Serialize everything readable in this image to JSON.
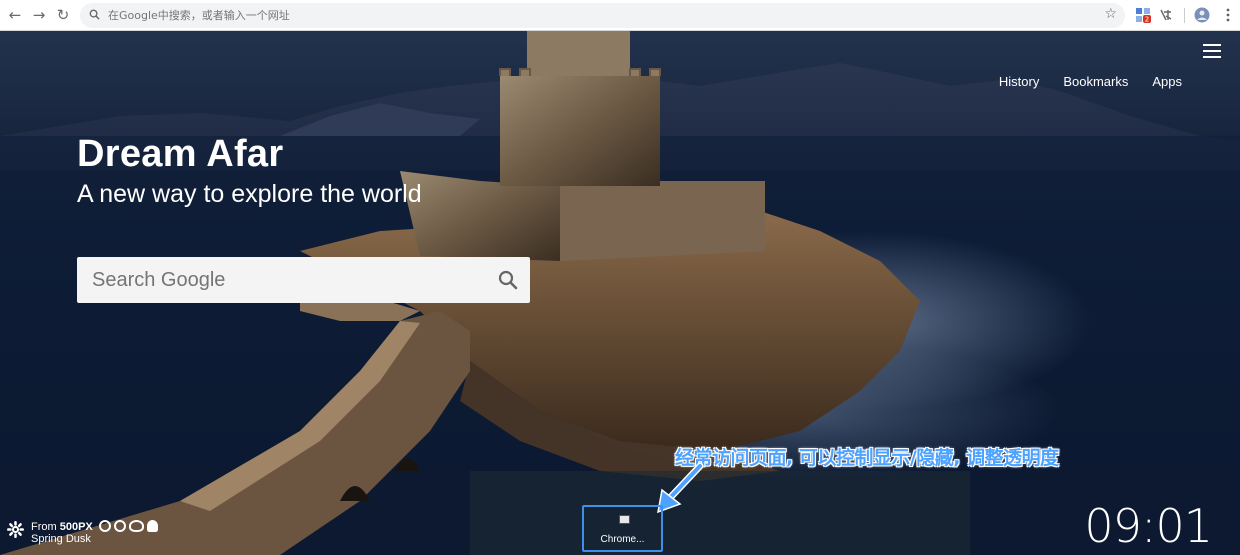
{
  "browser": {
    "address_placeholder": "在Google中搜索，或者输入一个网址",
    "back_icon": "back-arrow-icon",
    "forward_icon": "forward-arrow-icon",
    "reload_icon": "reload-icon",
    "extension_badge": "2"
  },
  "nav": {
    "history": "History",
    "bookmarks": "Bookmarks",
    "apps": "Apps"
  },
  "brand": {
    "title": "Dream Afar",
    "subtitle": "A new way to explore the world"
  },
  "search": {
    "placeholder": "Search Google"
  },
  "annotation": {
    "text": "经常访问页面, 可以控制显示/隐藏, 调整透明度"
  },
  "shortcut": {
    "label": "Chrome..."
  },
  "credits": {
    "prefix": "From ",
    "source": "500PX",
    "photo_title": "Spring Dusk"
  },
  "clock": {
    "time": "09:01"
  },
  "colors": {
    "annotation_blue": "#4da3ff",
    "shortcut_border": "#3d8fe8",
    "toolbar_bg": "#ffffff"
  }
}
